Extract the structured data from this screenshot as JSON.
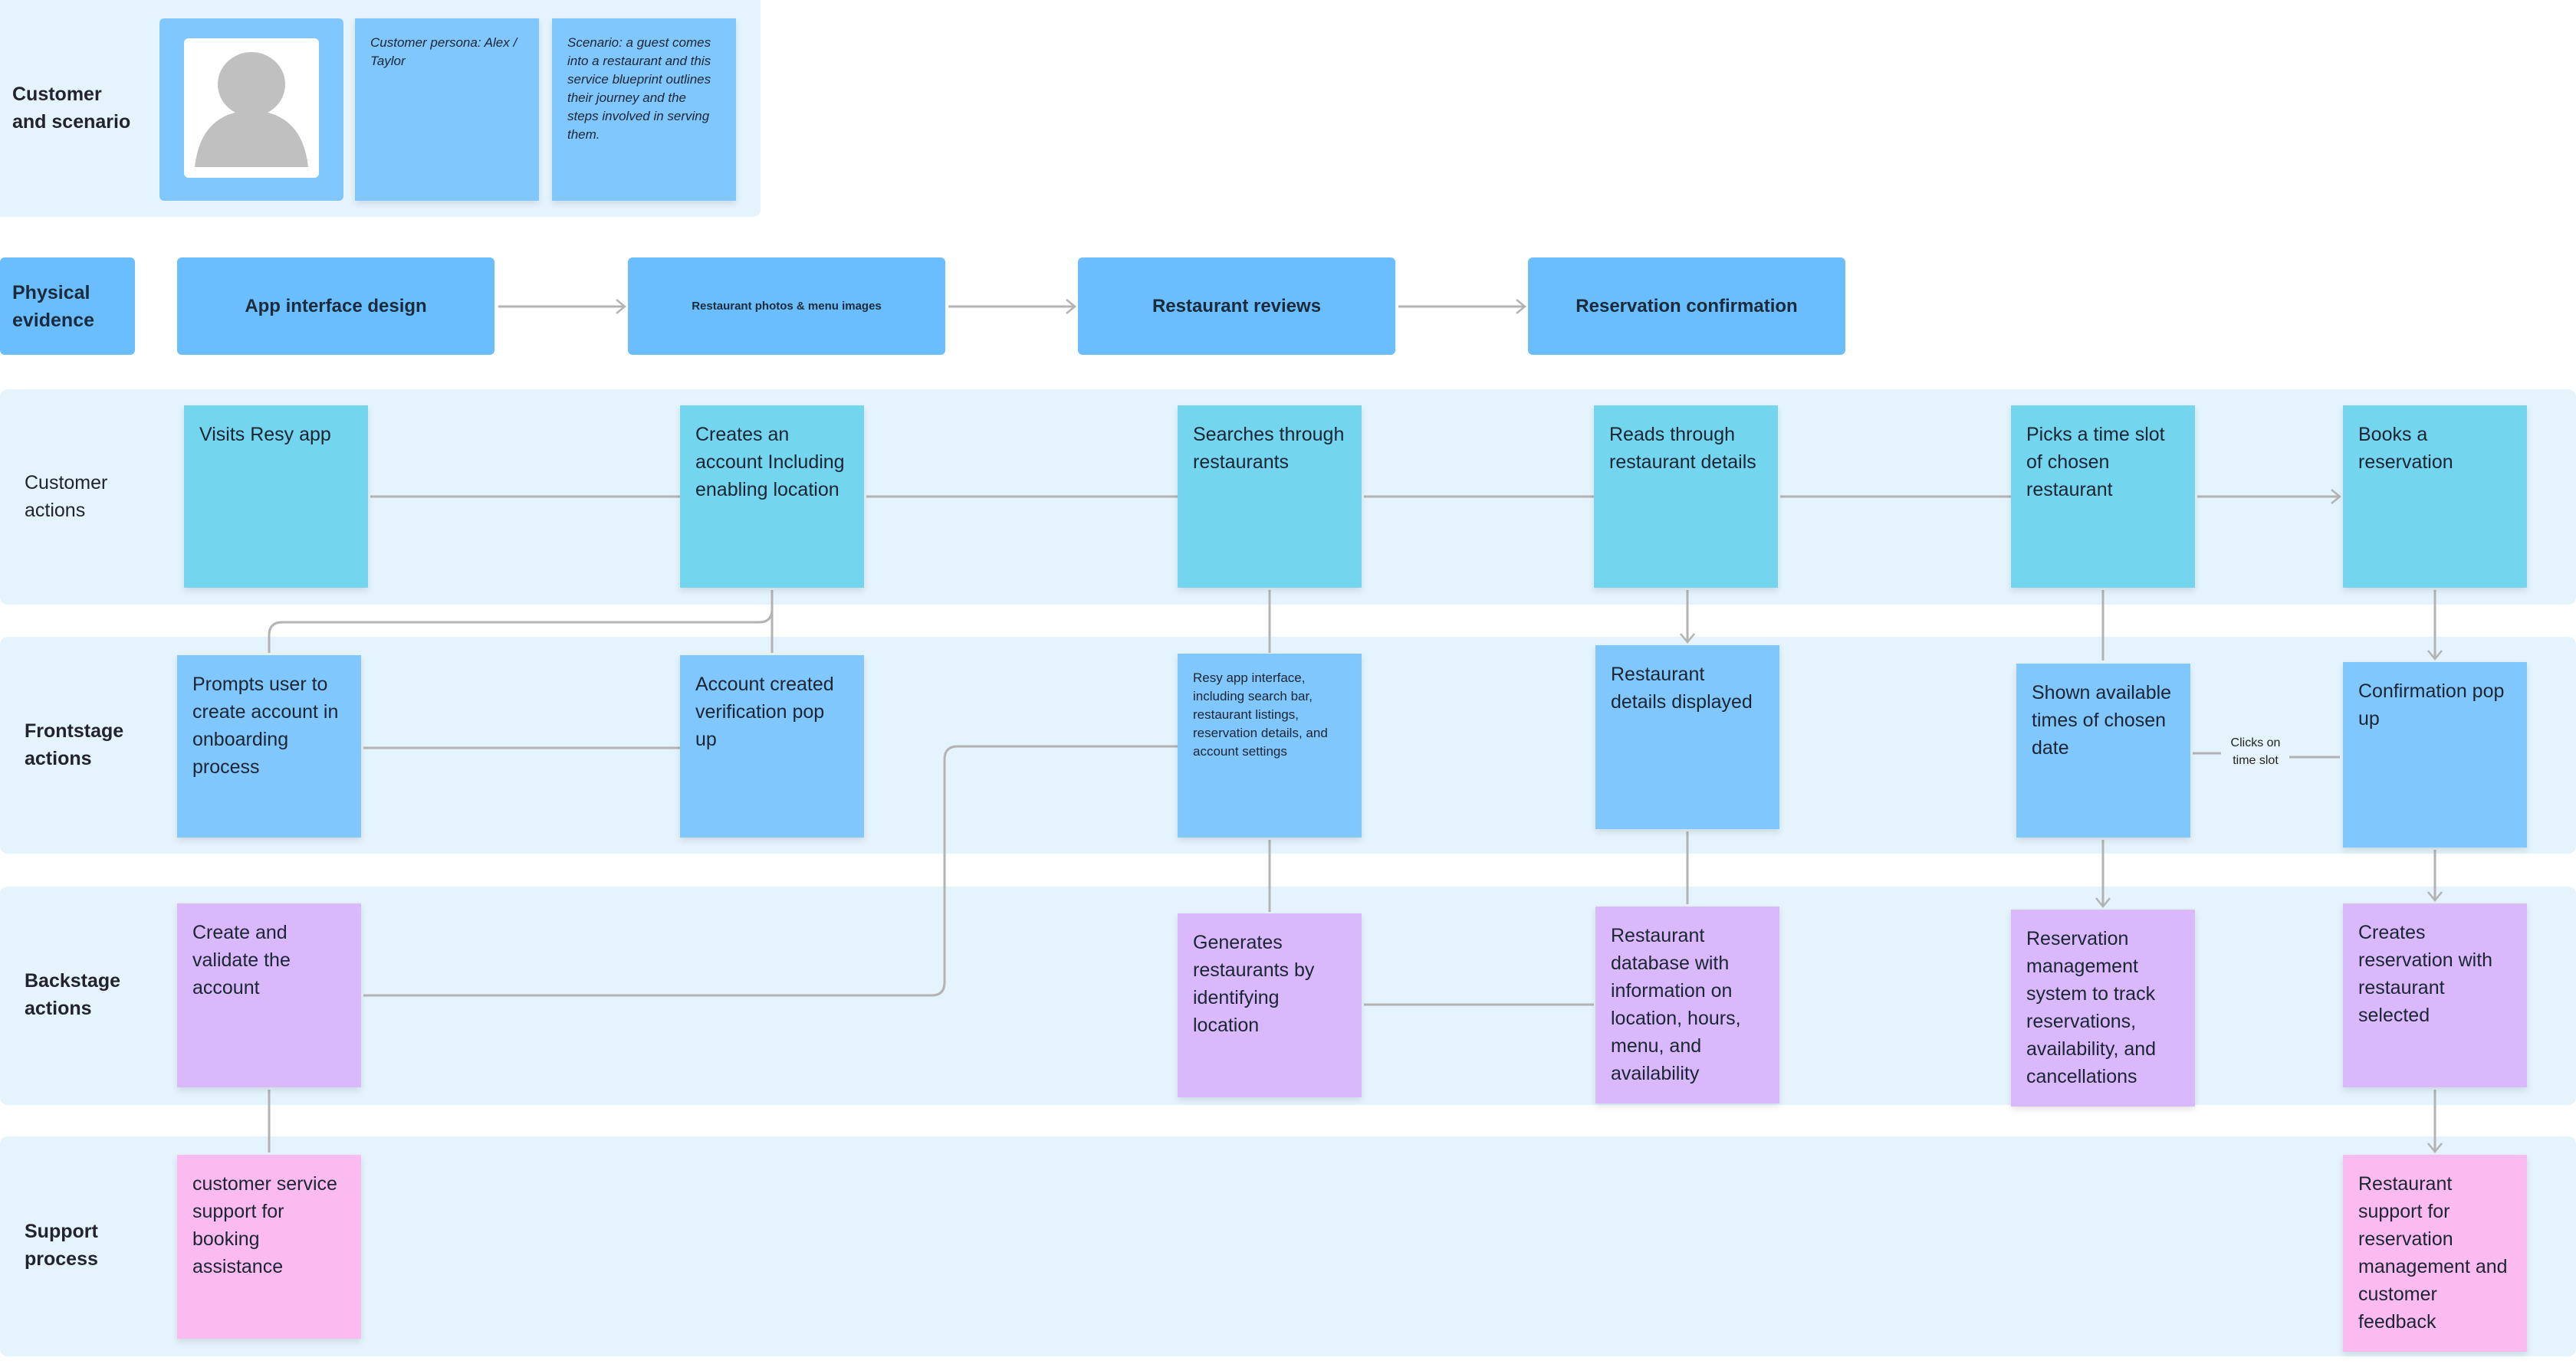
{
  "lanes": {
    "customer_scenario": "Customer and scenario",
    "physical_evidence": "Physical evidence",
    "customer_actions": "Customer actions",
    "frontstage_actions": "Frontstage actions",
    "backstage_actions": "Backstage actions",
    "support_process": "Support process"
  },
  "scenario": {
    "persona_image": "avatar-placeholder",
    "persona": "Customer persona: Alex / Taylor",
    "description": "Scenario: a guest comes into a restaurant and this service blueprint outlines their journey and the steps involved in serving them."
  },
  "physical_evidence": [
    "App interface design",
    "Restaurant photos & menu images",
    "Restaurant reviews",
    "Reservation confirmation"
  ],
  "customer_actions": [
    "Visits Resy app",
    "Creates an account Including enabling location",
    "Searches through restaurants",
    "Reads through restaurant details",
    "Picks a time slot of chosen restaurant",
    "Books a reservation"
  ],
  "frontstage_actions": [
    "Prompts user to create account in onboarding process",
    "Account created verification pop up",
    "Resy app interface, including search bar, restaurant listings, reservation details, and account settings",
    "Restaurant details displayed",
    "Shown available times of chosen date",
    "Confirmation pop up"
  ],
  "backstage_actions": [
    "Create and validate the account",
    "Generates restaurants by identifying location",
    "Restaurant database with information on location, hours, menu, and availability",
    "Reservation management system to track reservations, availability, and cancellations",
    "Creates reservation with restaurant selected"
  ],
  "support_process": [
    "customer service support for booking assistance",
    "Restaurant support for reservation management and customer feedback"
  ],
  "edge_labels": {
    "clicks_time_slot": "Clicks on time slot"
  },
  "colors": {
    "lane_bg": "#e4f3fc",
    "customer_card": "#74d5ee",
    "frontstage_card": "#80c7fd",
    "backstage_card": "#d9b8fb",
    "support_card": "#fcbbf0",
    "evidence_box": "#6bbefd",
    "connector": "#b3b3b3"
  }
}
